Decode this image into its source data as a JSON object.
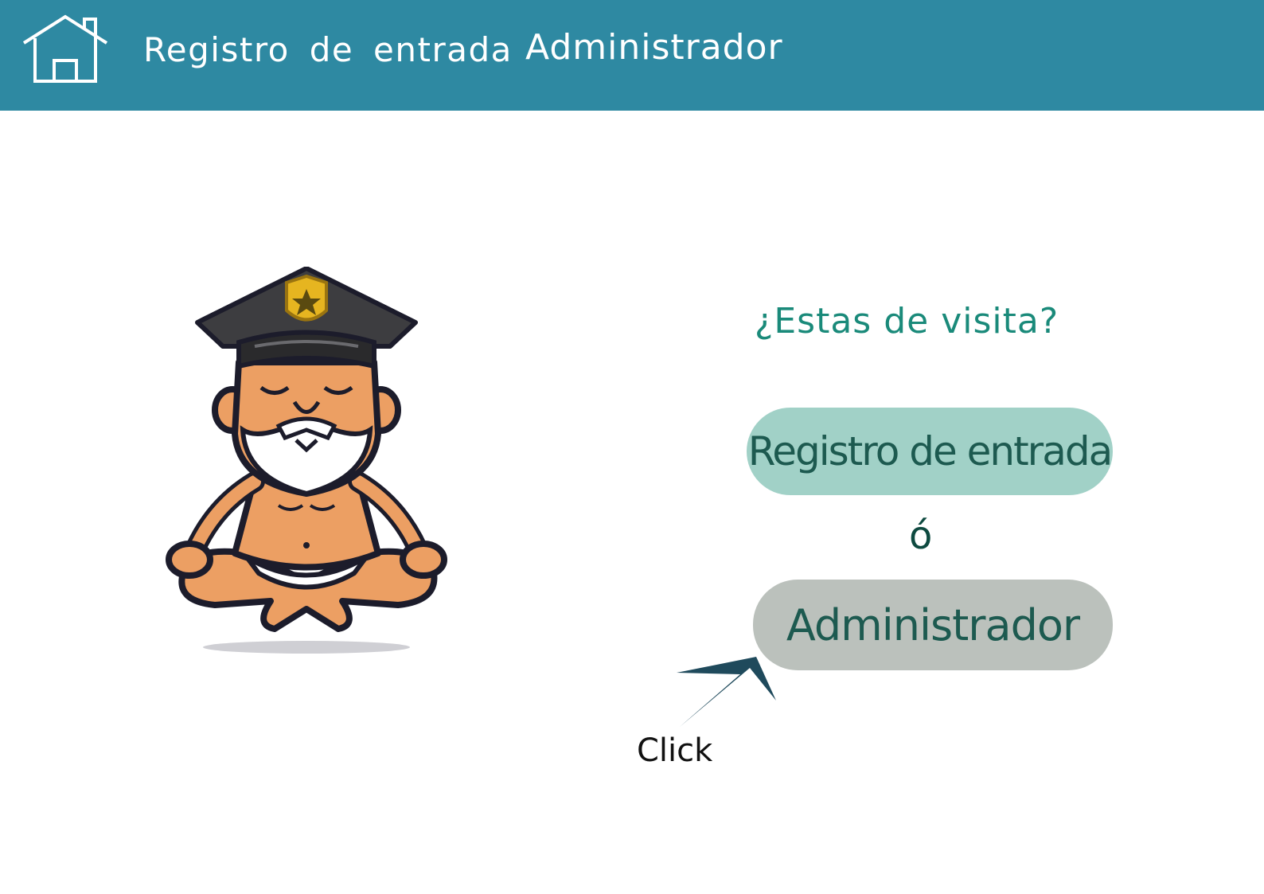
{
  "header": {
    "home_icon": "home-icon",
    "nav_registro": "Registro de entrada",
    "nav_admin": "Administrador",
    "background_color": "#2e89a2"
  },
  "main": {
    "question": "¿Estas de visita?",
    "registro_button": "Registro de entrada",
    "or_text": "ó",
    "admin_button": "Administrador",
    "hint_label": "Click",
    "hint_icon": "arrow-pointer-icon",
    "mascot": "meditating-police-officer-illustration",
    "colors": {
      "question": "#1a8a7a",
      "registro_button_bg": "#a1d1c7",
      "admin_button_bg": "#bbc1bc",
      "button_text": "#1d5a50"
    }
  }
}
